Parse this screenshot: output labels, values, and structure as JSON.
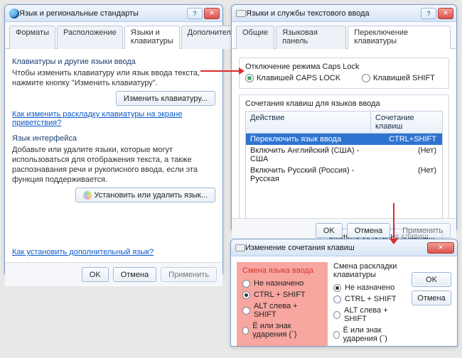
{
  "win1": {
    "title": "Язык и региональные стандарты",
    "tabs": [
      "Форматы",
      "Расположение",
      "Языки и клавиатуры",
      "Дополнительно"
    ],
    "active_tab": 2,
    "section1_title": "Клавиатуры и другие языки ввода",
    "section1_text": "Чтобы изменить клавиатуру или язык ввода текста, нажмите кнопку \"Изменить клавиатуру\".",
    "btn_change_kbd": "Изменить клавиатуру...",
    "link_welcome": "Как изменить раскладку клавиатуры на экране приветствия?",
    "section2_title": "Язык интерфейса",
    "section2_text": "Добавьте или удалите языки, которые могут использоваться для отображения текста, а также распознавания речи и рукописного ввода, если эта функция поддерживается.",
    "btn_install_lang": "Установить или удалить язык...",
    "link_additional": "Как установить дополнительный язык?",
    "btn_ok": "OK",
    "btn_cancel": "Отмена",
    "btn_apply": "Применить"
  },
  "win2": {
    "title": "Языки и службы текстового ввода",
    "tabs": [
      "Общие",
      "Языковая панель",
      "Переключение клавиатуры"
    ],
    "active_tab": 2,
    "caps_title": "Отключение режима Caps Lock",
    "opt_caps": "Клавишей CAPS LOCK",
    "opt_shift": "Клавишей SHIFT",
    "hot_title": "Сочетания клавиш для языков ввода",
    "col_action": "Действие",
    "col_combo": "Сочетание клавиш",
    "rows": [
      {
        "action": "Переключить язык ввода",
        "combo": "CTRL+SHIFT"
      },
      {
        "action": "Включить Английский (США) - США",
        "combo": "(Нет)"
      },
      {
        "action": "Включить Русский (Россия) - Русская",
        "combo": "(Нет)"
      }
    ],
    "btn_change_combo": "Сменить сочетание клавиш...",
    "btn_ok": "OK",
    "btn_cancel": "Отмена",
    "btn_apply": "Применить"
  },
  "win3": {
    "title": "Изменение сочетания клавиш",
    "left_legend": "Смена языка ввода",
    "right_legend": "Смена раскладки клавиатуры",
    "opts_left": [
      "Не назначено",
      "CTRL + SHIFT",
      "ALT слева + SHIFT",
      "Ё или знак ударения (`)"
    ],
    "opts_right": [
      "Не назначено",
      "CTRL + SHIFT",
      "ALT слева + SHIFT",
      "Ё или знак ударения (`)"
    ],
    "sel_left": 1,
    "sel_right": 0,
    "btn_ok": "OK",
    "btn_cancel": "Отмена"
  }
}
